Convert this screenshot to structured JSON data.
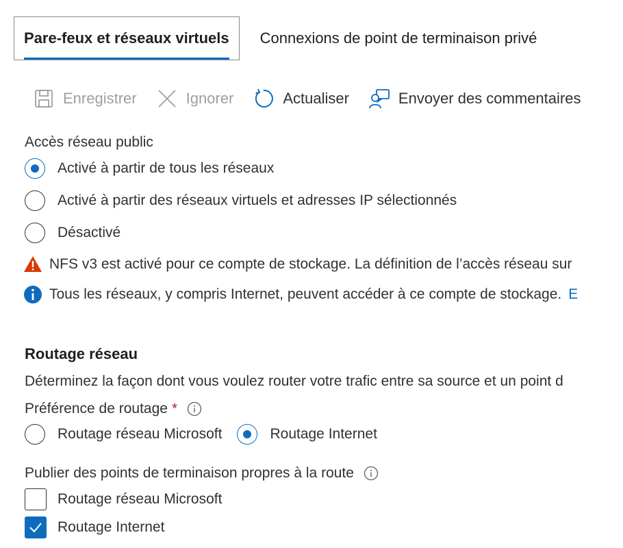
{
  "tabs": [
    {
      "label": "Pare-feux et réseaux virtuels",
      "active": true
    },
    {
      "label": "Connexions de point de terminaison privé",
      "active": false
    }
  ],
  "toolbar": {
    "save": {
      "label": "Enregistrer",
      "icon": "save-icon",
      "disabled": true
    },
    "discard": {
      "label": "Ignorer",
      "icon": "close-icon",
      "disabled": true
    },
    "refresh": {
      "label": "Actualiser",
      "icon": "refresh-icon",
      "disabled": false
    },
    "feedback": {
      "label": "Envoyer des commentaires",
      "icon": "feedback-icon",
      "disabled": false
    }
  },
  "public_access": {
    "label": "Accès réseau public",
    "options": [
      {
        "label": "Activé à partir de tous les réseaux",
        "selected": true
      },
      {
        "label": "Activé à partir des réseaux virtuels et adresses IP sélectionnés",
        "selected": false
      },
      {
        "label": "Désactivé",
        "selected": false
      }
    ]
  },
  "messages": {
    "warning": "NFS v3 est activé pour ce compte de stockage. La définition de l’accès réseau sur",
    "info": "Tous les réseaux, y compris Internet, peuvent accéder à ce compte de stockage.",
    "info_link": "E"
  },
  "routing": {
    "title": "Routage réseau",
    "description": "Déterminez la façon dont vous voulez router votre trafic entre sa source et un point d",
    "preference_label": "Préférence de routage",
    "required_mark": "*",
    "preference_options": [
      {
        "label": "Routage réseau Microsoft",
        "selected": false
      },
      {
        "label": "Routage Internet",
        "selected": true
      }
    ],
    "publish_label": "Publier des points de terminaison propres à la route",
    "publish_options": [
      {
        "label": "Routage réseau Microsoft",
        "checked": false
      },
      {
        "label": "Routage Internet",
        "checked": true
      }
    ]
  },
  "colors": {
    "accent": "#0f6cbd",
    "warning": "#d83b01",
    "disabled": "#a19f9d"
  }
}
